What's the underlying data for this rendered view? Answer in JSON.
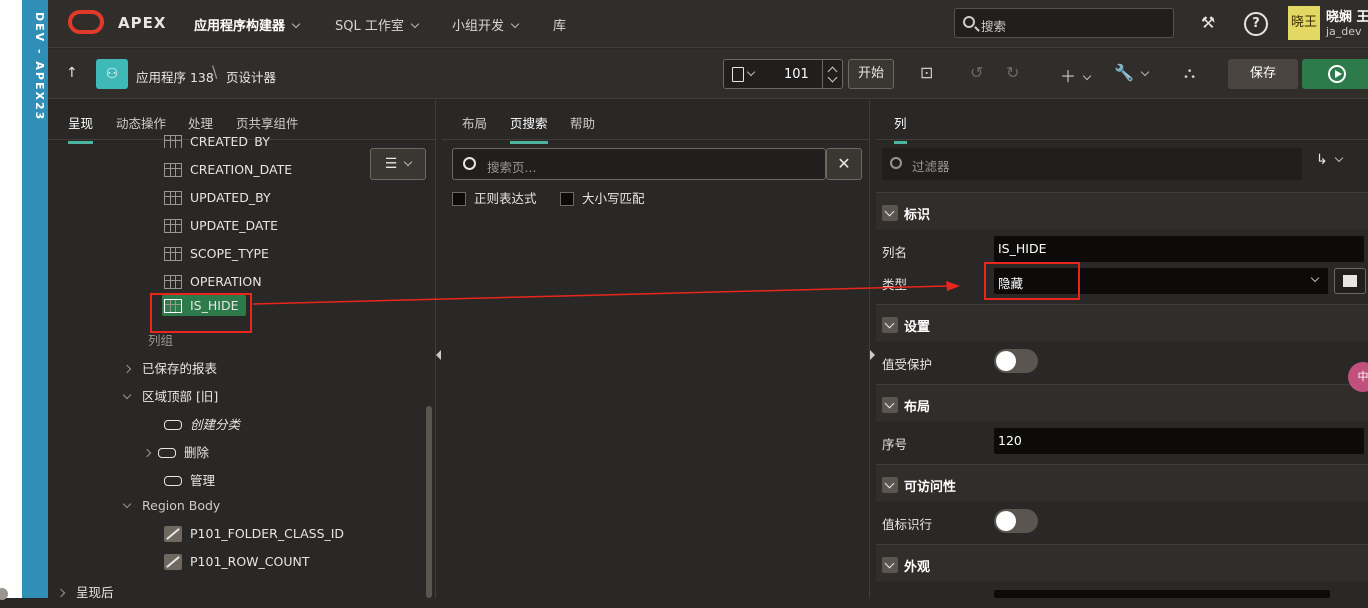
{
  "env": {
    "label": "DEV - APEX23"
  },
  "topnav": {
    "brand": "APEX",
    "menus": [
      {
        "label": "应用程序构建器"
      },
      {
        "label": "SQL 工作室"
      },
      {
        "label": "小组开发"
      },
      {
        "label": "库"
      }
    ],
    "search_placeholder": "搜索",
    "user": {
      "avatar_text": "晓王",
      "name": "晓娴 王",
      "id": "ja_dev"
    }
  },
  "toolbar": {
    "breadcrumb_app": "应用程序 138",
    "breadcrumb_page": "页设计器",
    "page_number": "101",
    "go_label": "开始",
    "save_label": "保存"
  },
  "left": {
    "tabs": [
      "呈现",
      "动态操作",
      "处理",
      "页共享组件"
    ],
    "tree": {
      "created_by": "CREATED_BY",
      "creation_date": "CREATION_DATE",
      "updated_by": "UPDATED_BY",
      "update_date": "UPDATE_DATE",
      "scope_type": "SCOPE_TYPE",
      "operation": "OPERATION",
      "is_hide": "IS_HIDE",
      "column_group": "列组",
      "saved_reports": "已保存的报表",
      "region_top": "区域顶部 [旧]",
      "create_category": "创建分类",
      "delete": "删除",
      "manage": "管理",
      "region_body": "Region Body",
      "folder_class_id": "P101_FOLDER_CLASS_ID",
      "row_count": "P101_ROW_COUNT",
      "after_render": "呈现后"
    }
  },
  "middle": {
    "tabs": [
      "布局",
      "页搜索",
      "帮助"
    ],
    "search_placeholder": "搜索页...",
    "regex_label": "正则表达式",
    "case_label": "大小写匹配"
  },
  "right": {
    "tab": "列",
    "filter_placeholder": "过滤器",
    "sections": {
      "identification": "标识",
      "settings": "设置",
      "layout": "布局",
      "accessibility": "可访问性",
      "appearance": "外观"
    },
    "fields": {
      "column_name_label": "列名",
      "column_name_value": "IS_HIDE",
      "type_label": "类型",
      "type_value": "隐藏",
      "protected_label": "值受保护",
      "sequence_label": "序号",
      "sequence_value": "120",
      "row_header_label": "值标识行"
    }
  },
  "float_badge": "中",
  "colors": {
    "accent": "#2d7a4b",
    "annotation": "#e8261c",
    "env": "#2f8fb6"
  }
}
